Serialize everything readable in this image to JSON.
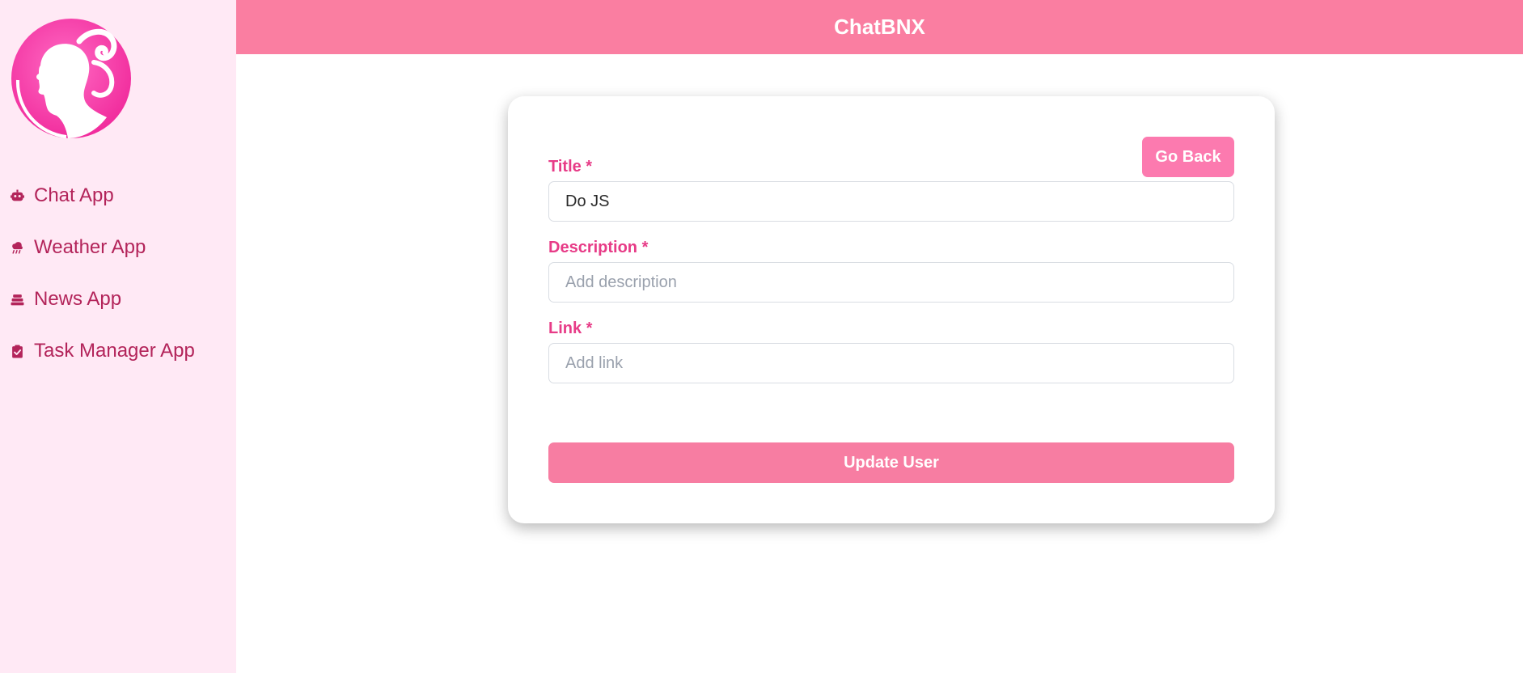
{
  "app": {
    "title": "ChatBNX"
  },
  "brand": {
    "primary": "#fa7ea1",
    "sidebar_bg": "#ffe9f5",
    "nav_text": "#b3245a",
    "label_color": "#e73b87",
    "button": "#fc7aaf"
  },
  "sidebar": {
    "logo_icon": "silhouette-logo",
    "items": [
      {
        "label": "Chat App",
        "icon": "robot-icon"
      },
      {
        "label": "Weather App",
        "icon": "cloud-rain-icon"
      },
      {
        "label": "News App",
        "icon": "layers-icon"
      },
      {
        "label": "Task Manager App",
        "icon": "clipboard-check-icon"
      }
    ]
  },
  "form": {
    "go_back_label": "Go Back",
    "title_label": "Title *",
    "title_value": "Do JS",
    "title_placeholder": "",
    "description_label": "Description *",
    "description_value": "",
    "description_placeholder": "Add description",
    "link_label": "Link *",
    "link_value": "",
    "link_placeholder": "Add link",
    "submit_label": "Update User"
  }
}
